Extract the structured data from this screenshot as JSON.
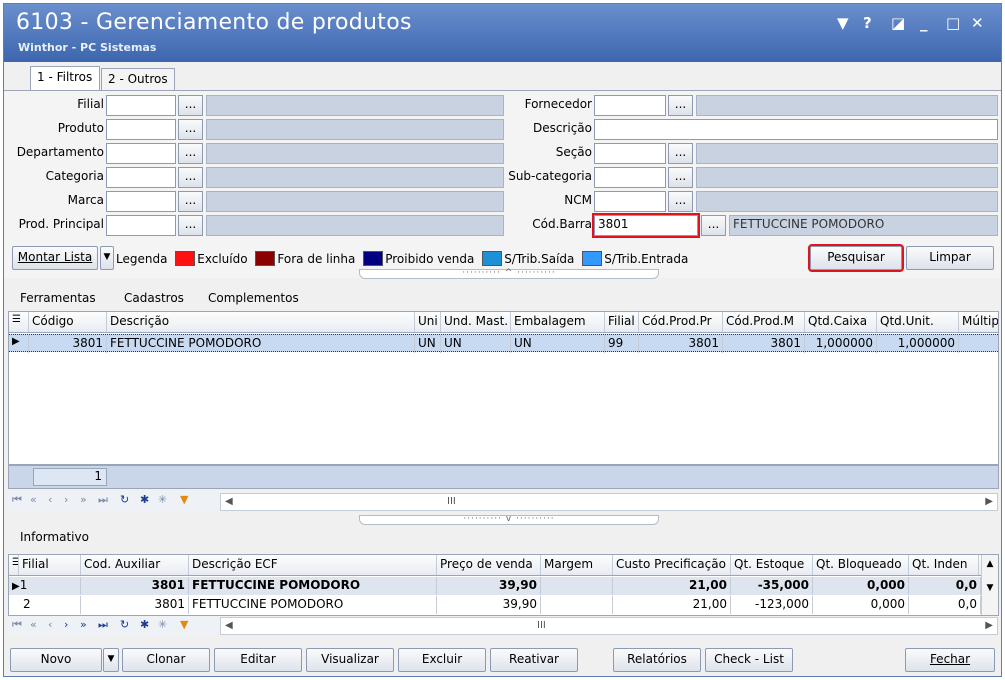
{
  "window": {
    "title": "6103 - Gerenciamento de produtos",
    "subtitle": "Winthor - PC Sistemas",
    "controls": [
      "▼",
      "?",
      "◪",
      "_",
      "□",
      "✕"
    ]
  },
  "tabs": [
    "1 - Filtros",
    "2 - Outros"
  ],
  "filters": {
    "filial": {
      "label": "Filial",
      "value": ""
    },
    "produto": {
      "label": "Produto",
      "value": ""
    },
    "departamento": {
      "label": "Departamento",
      "value": ""
    },
    "categoria": {
      "label": "Categoria",
      "value": ""
    },
    "marca": {
      "label": "Marca",
      "value": ""
    },
    "prod_principal": {
      "label": "Prod. Principal",
      "value": ""
    },
    "fornecedor": {
      "label": "Fornecedor",
      "value": ""
    },
    "descricao": {
      "label": "Descrição",
      "value": ""
    },
    "secao": {
      "label": "Seção",
      "value": ""
    },
    "subcategoria": {
      "label": "Sub-categoria",
      "value": ""
    },
    "ncm": {
      "label": "NCM",
      "value": ""
    },
    "cod_barra": {
      "label": "Cód.Barra",
      "value": "3801",
      "description": "FETTUCCINE POMODORO"
    },
    "dots": "..."
  },
  "toolbar": {
    "montar_lista": "Montar Lista",
    "legenda": "Legenda",
    "pesquisar": "Pesquisar",
    "limpar": "Limpar"
  },
  "legend": [
    {
      "label": "Excluído",
      "color": "#ff1111"
    },
    {
      "label": "Fora de linha",
      "color": "#8b0000"
    },
    {
      "label": "Proibido venda",
      "color": "#000080"
    },
    {
      "label": "S/Trib.Saída",
      "color": "#1e90d6"
    },
    {
      "label": "S/Trib.Entrada",
      "color": "#3399ff"
    }
  ],
  "menu": [
    "Ferramentas",
    "Cadastros",
    "Complementos"
  ],
  "grid1": {
    "columns": [
      "Código",
      "Descrição",
      "Uni",
      "Und. Mast.",
      "Embalagem",
      "Filial",
      "Cód.Prod.Pr",
      "Cód.Prod.M",
      "Qtd.Caixa",
      "Qtd.Unit.",
      "Múltip"
    ],
    "rows": [
      [
        "3801",
        "FETTUCCINE POMODORO",
        "UN",
        "UN",
        "UN",
        "99",
        "3801",
        "3801",
        "1,000000",
        "1,000000",
        ""
      ]
    ],
    "count": "1"
  },
  "informativo": {
    "label": "Informativo",
    "columns": [
      "Filial",
      "Cod. Auxiliar",
      "Descrição ECF",
      "Preço de venda",
      "Margem",
      "Custo Precificação",
      "Qt. Estoque",
      "Qt. Bloqueado",
      "Qt. Inden"
    ],
    "rows": [
      [
        "1",
        "3801",
        "FETTUCCINE POMODORO",
        "39,90",
        "",
        "21,00",
        "-35,000",
        "0,000",
        "0,0"
      ],
      [
        "2",
        "3801",
        "FETTUCCINE POMODORO",
        "39,90",
        "",
        "21,00",
        "-123,000",
        "0,000",
        "0,0"
      ]
    ]
  },
  "footer": {
    "novo": "Novo",
    "clonar": "Clonar",
    "editar": "Editar",
    "visualizar": "Visualizar",
    "excluir": "Excluir",
    "reativar": "Reativar",
    "relatorios": "Relatórios",
    "checklist": "Check - List",
    "fechar": "Fechar"
  },
  "colors": {
    "titlebar": "#4a73b8",
    "highlight": "#e0141e"
  }
}
